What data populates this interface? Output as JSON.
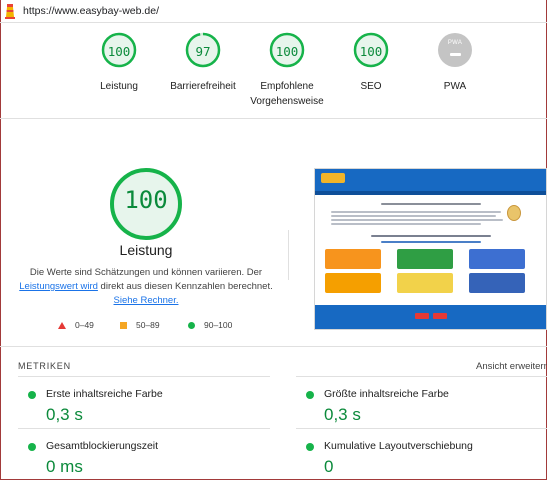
{
  "url": "https://www.easybay-web.de/",
  "colors": {
    "pass": "#0b8a3b",
    "pass_fill": "#16b34a",
    "gauge_bg": "#e7f5ec",
    "pwa_gray": "#9e9e9e",
    "link": "#1a73e8"
  },
  "categories": [
    {
      "score": "100",
      "label": "Leistung",
      "value": 1.0
    },
    {
      "score": "97",
      "label": "Barrierefreiheit",
      "value": 0.97
    },
    {
      "score": "100",
      "label": "Empfohlene Vorgehensweise",
      "value": 1.0
    },
    {
      "score": "100",
      "label": "SEO",
      "value": 1.0
    },
    {
      "score": "",
      "label": "PWA",
      "badge": "PWA"
    }
  ],
  "performance": {
    "score": "100",
    "title": "Leistung",
    "desc_part1": "Die Werte sind Schätzungen und können variieren. Der ",
    "desc_link1": "Leistungswert wird",
    "desc_part2": " direkt aus diesen Kennzahlen berechnet. ",
    "desc_link2": "Siehe Rechner."
  },
  "legend": [
    {
      "range": "0–49",
      "icon": "red-triangle-icon"
    },
    {
      "range": "50–89",
      "icon": "orange-square-icon"
    },
    {
      "range": "90–100",
      "icon": "green-circle-icon"
    }
  ],
  "metrics": {
    "heading": "METRIKEN",
    "toggle": "Ansicht erweitern",
    "items": [
      {
        "label": "Erste inhaltsreiche Farbe",
        "value": "0,3 s"
      },
      {
        "label": "Größte inhaltsreiche Farbe",
        "value": "0,3 s"
      },
      {
        "label": "Gesamtblockierungszeit",
        "value": "0 ms"
      },
      {
        "label": "Kumulative Layoutverschiebung",
        "value": "0"
      }
    ]
  }
}
